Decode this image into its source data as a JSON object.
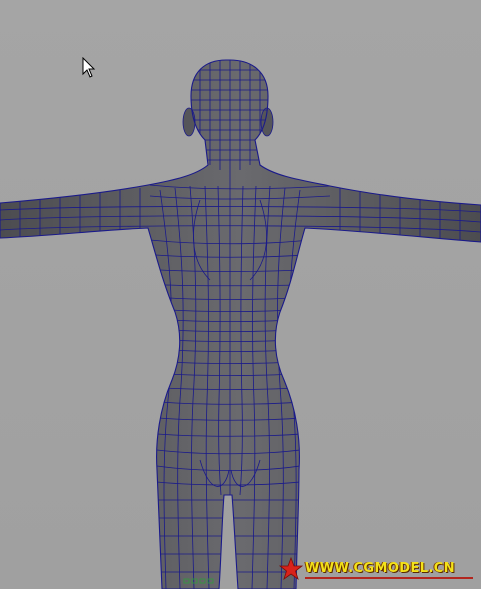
{
  "viewport": {
    "background": "#a1a1a1",
    "wire_color": "#1a1a8a",
    "mesh_fill": "#5d5d60"
  },
  "watermark": {
    "text": "WWW.CGMODEL.CN",
    "text_color": "#f3e21a",
    "underline_color": "#b3261e",
    "icon": "star-icon"
  },
  "cursor": {
    "icon": "arrow-cursor-icon"
  }
}
